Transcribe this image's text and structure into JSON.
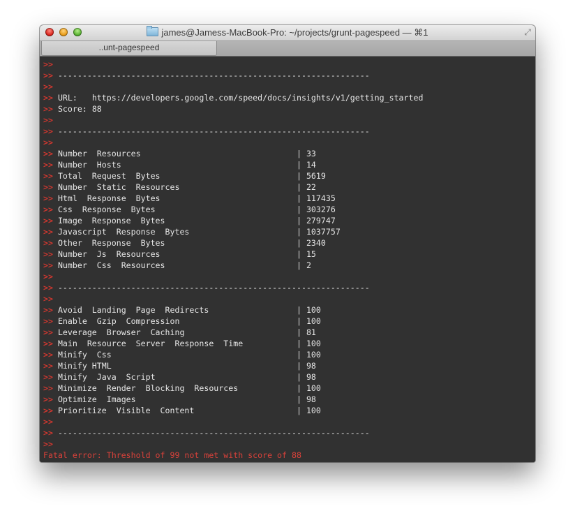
{
  "window": {
    "title": "james@Jamess-MacBook-Pro: ~/projects/grunt-pagespeed — ⌘1",
    "tab_label": "..unt-pagespeed",
    "icons": {
      "folder": "folder-icon",
      "fullscreen": "fullscreen-icon"
    }
  },
  "terminal": {
    "prompt": ">>",
    "separator": "----------------------------------------------------------------",
    "url_label": "URL:",
    "url": "https://developers.google.com/speed/docs/insights/v1/getting_started",
    "score_label": "Score:",
    "score": "88",
    "stats": [
      {
        "label": "Number  Resources",
        "value": "33"
      },
      {
        "label": "Number  Hosts",
        "value": "14"
      },
      {
        "label": "Total  Request  Bytes",
        "value": "5619"
      },
      {
        "label": "Number  Static  Resources",
        "value": "22"
      },
      {
        "label": "Html  Response  Bytes",
        "value": "117435"
      },
      {
        "label": "Css  Response  Bytes",
        "value": "303276"
      },
      {
        "label": "Image  Response  Bytes",
        "value": "279747"
      },
      {
        "label": "Javascript  Response  Bytes",
        "value": "1037757"
      },
      {
        "label": "Other  Response  Bytes",
        "value": "2340"
      },
      {
        "label": "Number  Js  Resources",
        "value": "15"
      },
      {
        "label": "Number  Css  Resources",
        "value": "2"
      }
    ],
    "rules": [
      {
        "label": "Avoid  Landing  Page  Redirects",
        "value": "100"
      },
      {
        "label": "Enable  Gzip  Compression",
        "value": "100"
      },
      {
        "label": "Leverage  Browser  Caching",
        "value": "81"
      },
      {
        "label": "Main  Resource  Server  Response  Time",
        "value": "100"
      },
      {
        "label": "Minify  Css",
        "value": "100"
      },
      {
        "label": "Minify HTML",
        "value": "98"
      },
      {
        "label": "Minify  Java  Script",
        "value": "98"
      },
      {
        "label": "Minimize  Render  Blocking  Resources",
        "value": "100"
      },
      {
        "label": "Optimize  Images",
        "value": "98"
      },
      {
        "label": "Prioritize  Visible  Content",
        "value": "100"
      }
    ],
    "error": "Fatal error: Threshold of 99 not met with score of 88"
  },
  "colors": {
    "prompt": "#d3372f",
    "error": "#d8413a",
    "background": "#313131",
    "text": "#e6e6e6"
  }
}
